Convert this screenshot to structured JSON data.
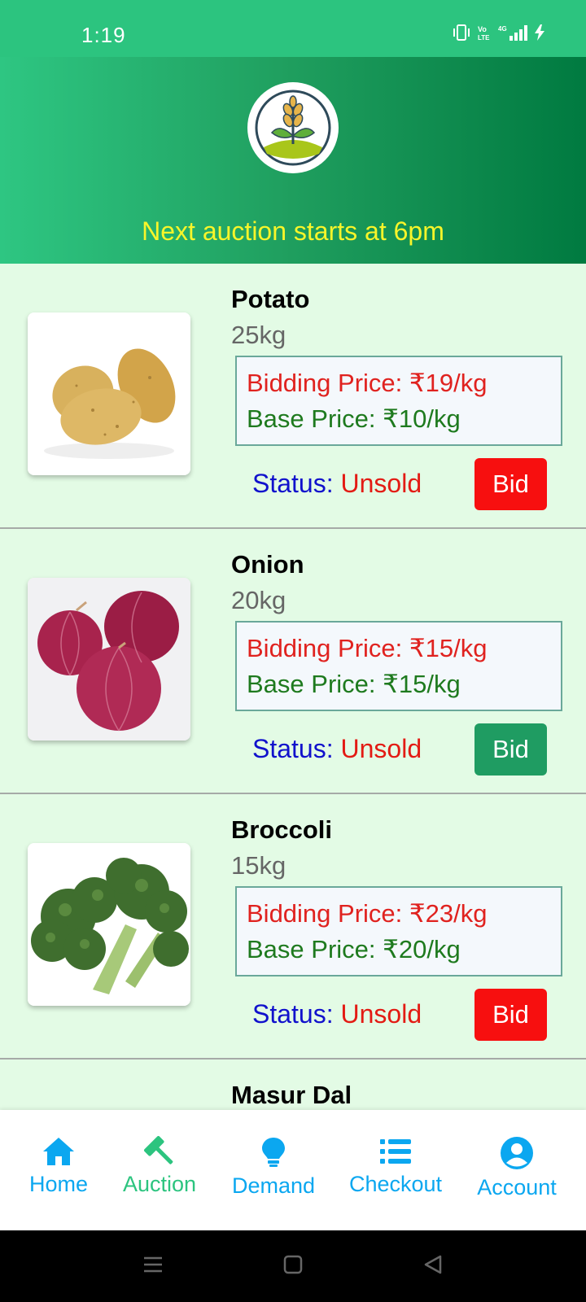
{
  "status_bar": {
    "time": "1:19",
    "network": "4G"
  },
  "header": {
    "banner_text": "Next auction starts at 6pm"
  },
  "products": [
    {
      "name": "Potato",
      "quantity": "25kg",
      "bidding_price": "Bidding Price: ₹19/kg",
      "base_price": "Base Price: ₹10/kg",
      "status_label": "Status: ",
      "status_value": "Unsold",
      "bid_label": "Bid",
      "bid_color": "#f70f0f"
    },
    {
      "name": "Onion",
      "quantity": "20kg",
      "bidding_price": "Bidding Price: ₹15/kg",
      "base_price": "Base Price: ₹15/kg",
      "status_label": "Status: ",
      "status_value": "Unsold",
      "bid_label": "Bid",
      "bid_color": "#1f9c62"
    },
    {
      "name": "Broccoli",
      "quantity": "15kg",
      "bidding_price": "Bidding Price: ₹23/kg",
      "base_price": "Base Price: ₹20/kg",
      "status_label": "Status: ",
      "status_value": "Unsold",
      "bid_label": "Bid",
      "bid_color": "#f70f0f"
    },
    {
      "name": "Masur Dal"
    }
  ],
  "bottom_nav": [
    {
      "label": "Home",
      "icon": "home-icon",
      "active": false
    },
    {
      "label": "Auction",
      "icon": "hammer-icon",
      "active": true
    },
    {
      "label": "Demand",
      "icon": "lightbulb-icon",
      "active": false
    },
    {
      "label": "Checkout",
      "icon": "list-icon",
      "active": false
    },
    {
      "label": "Account",
      "icon": "account-icon",
      "active": false
    }
  ],
  "colors": {
    "primary": "#2cc47f",
    "nav_blue": "#0ba7f0",
    "banner_text": "#f8f52a",
    "unsold_red": "#e31b14"
  }
}
